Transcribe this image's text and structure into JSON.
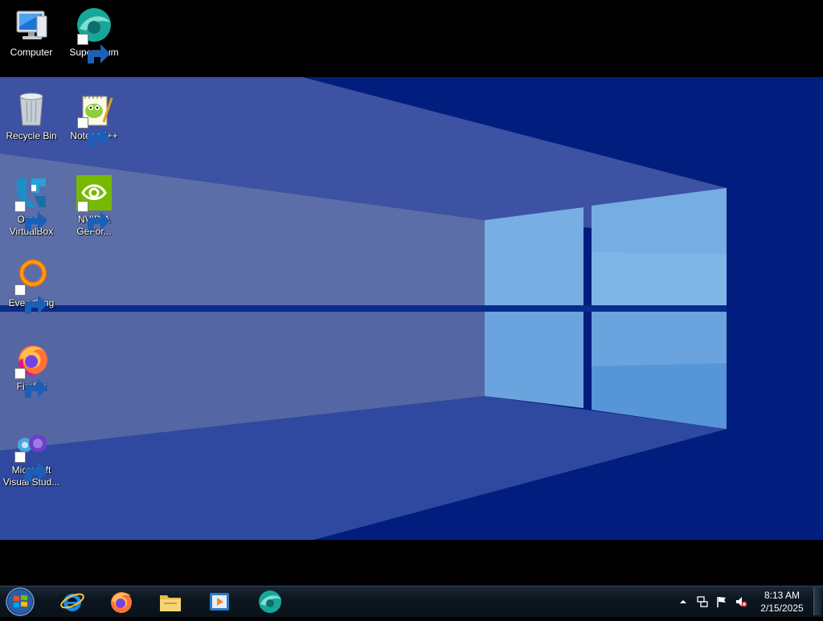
{
  "desktop": {
    "icons": [
      {
        "name": "computer-icon",
        "label": "Computer"
      },
      {
        "name": "supermium-icon",
        "label": "Supermium"
      },
      {
        "name": "recycle-bin-icon",
        "label": "Recycle Bin"
      },
      {
        "name": "notepad-plus-plus-icon",
        "label": "Notepad++"
      },
      {
        "name": "oracle-virtualbox-icon",
        "label": "Oracle\nVirtualBox"
      },
      {
        "name": "nvidia-geforce-icon",
        "label": "NVIDIA\nGeFor..."
      },
      {
        "name": "everything-icon",
        "label": "Everything"
      },
      {
        "name": "firefox-icon",
        "label": "Firefox"
      },
      {
        "name": "visual-studio-icon",
        "label": "Microsoft\nVisual Stud..."
      }
    ]
  },
  "taskbar": {
    "start": "start-orb-icon",
    "pinned": [
      "internet-explorer-icon",
      "firefox-icon",
      "file-explorer-icon",
      "media-player-icon",
      "supermium-icon"
    ],
    "tray": [
      "show-hidden-icons-chevron",
      "network-icon",
      "action-center-flag-icon",
      "volume-muted-icon"
    ],
    "clock": {
      "time": "8:13 AM",
      "date": "2/15/2025"
    }
  },
  "colors": {
    "wallpaper_dark": "#021d7c",
    "wallpaper_light": "#5b6fa9",
    "window_pane": "#7cb3e6",
    "taskbar": "#0d1620"
  }
}
